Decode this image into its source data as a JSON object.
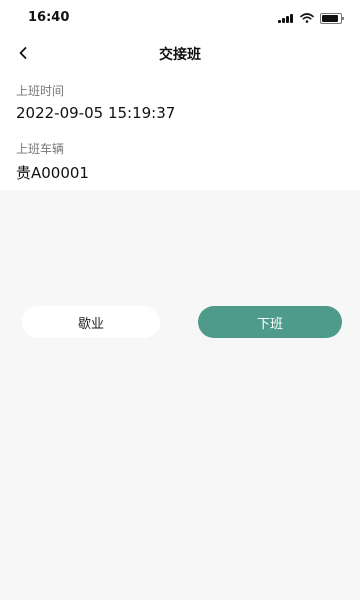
{
  "status_bar": {
    "time": "16:40",
    "icons": [
      "signal-icon",
      "wifi-icon",
      "battery-icon"
    ]
  },
  "nav": {
    "title": "交接班",
    "back_icon": "chevron-left-icon"
  },
  "form": {
    "shift_time_label": "上班时间",
    "shift_time_value": "2022-09-05 15:19:37",
    "vehicle_label": "上班车辆",
    "vehicle_value": "贵A00001"
  },
  "actions": {
    "rest_label": "歇业",
    "off_duty_label": "下班"
  },
  "colors": {
    "accent": "#4e9b8b",
    "background": "#f7f7f7",
    "card": "#ffffff"
  }
}
